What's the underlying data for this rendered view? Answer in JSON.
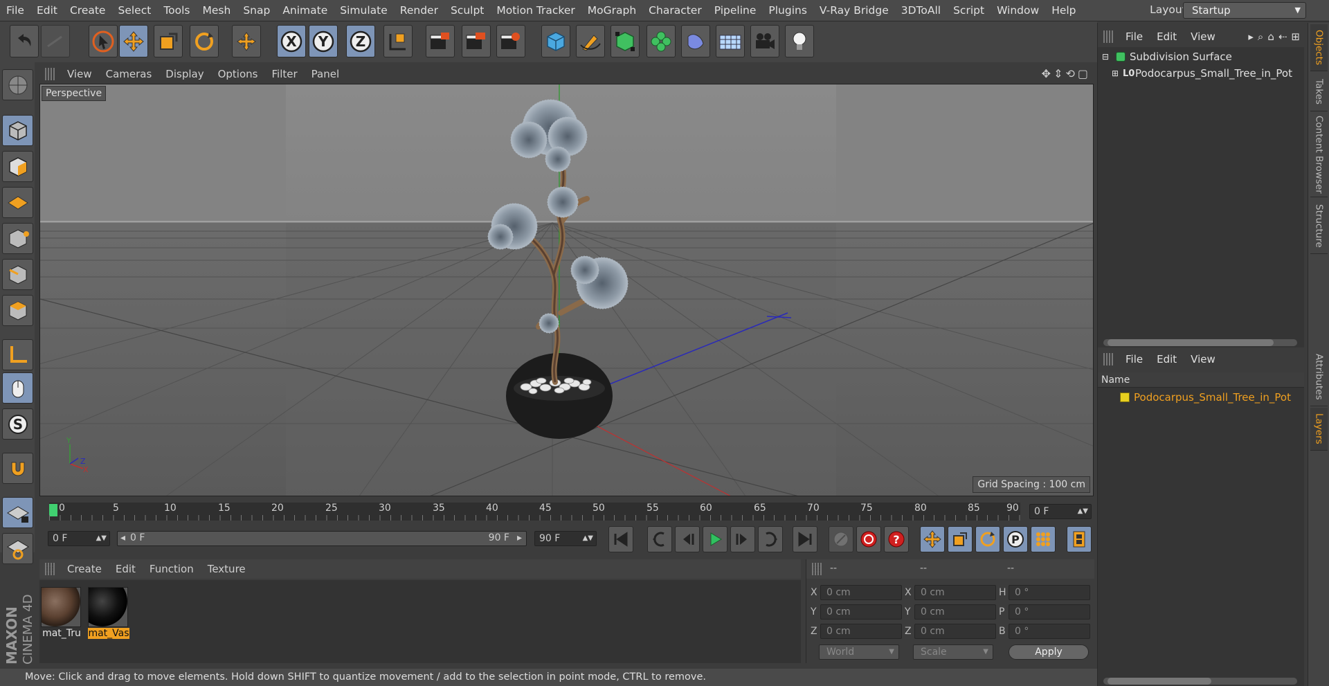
{
  "menubar": {
    "items": [
      "File",
      "Edit",
      "Create",
      "Select",
      "Tools",
      "Mesh",
      "Snap",
      "Animate",
      "Simulate",
      "Render",
      "Sculpt",
      "Motion Tracker",
      "MoGraph",
      "Character",
      "Pipeline",
      "Plugins",
      "V-Ray Bridge",
      "3DToAll",
      "Script",
      "Window",
      "Help"
    ],
    "layout_label": "Layout:",
    "layout_value": "Startup"
  },
  "toolbar": {
    "icons": [
      "undo-icon",
      "redo-icon",
      "select-arrow-icon",
      "move-icon",
      "scale-icon",
      "rotate-icon",
      "live-select-icon",
      "x-axis-icon",
      "y-axis-icon",
      "z-axis-icon",
      "coordinate-system-icon",
      "render-view-icon",
      "render-picture-viewer-icon",
      "render-settings-icon",
      "cube-icon",
      "pen-spline-icon",
      "subdivision-icon",
      "cloner-icon",
      "deformer-icon",
      "floor-icon",
      "camera-icon",
      "light-icon"
    ],
    "axis_labels": [
      "X",
      "Y",
      "Z"
    ]
  },
  "viewport": {
    "menu": [
      "View",
      "Cameras",
      "Display",
      "Options",
      "Filter",
      "Panel"
    ],
    "camera_label": "Perspective",
    "grid_spacing": "Grid Spacing : 100 cm",
    "axis_y": "Y",
    "axis_z": "Z",
    "axis_x": "X"
  },
  "timeline": {
    "ticks": [
      "0",
      "5",
      "10",
      "15",
      "20",
      "25",
      "30",
      "35",
      "40",
      "45",
      "50",
      "55",
      "60",
      "65",
      "70",
      "75",
      "80",
      "85",
      "90"
    ],
    "current_frame": "0 F",
    "start_field": "0 F",
    "range_start": "0 F",
    "range_end": "90 F",
    "end_field": "90 F"
  },
  "materials": {
    "menu": [
      "Create",
      "Edit",
      "Function",
      "Texture"
    ],
    "items": [
      {
        "name": "mat_Tru",
        "selected": false
      },
      {
        "name": "mat_Vas",
        "selected": true
      }
    ]
  },
  "coordinates": {
    "headers": [
      "--",
      "--",
      "--"
    ],
    "rows": [
      {
        "l1": "X",
        "v1": "0 cm",
        "l2": "X",
        "v2": "0 cm",
        "l3": "H",
        "v3": "0 °"
      },
      {
        "l1": "Y",
        "v1": "0 cm",
        "l2": "Y",
        "v2": "0 cm",
        "l3": "P",
        "v3": "0 °"
      },
      {
        "l1": "Z",
        "v1": "0 cm",
        "l2": "Z",
        "v2": "0 cm",
        "l3": "B",
        "v3": "0 °"
      }
    ],
    "mode1": "World",
    "mode2": "Scale",
    "apply": "Apply"
  },
  "objects_panel": {
    "menu": [
      "File",
      "Edit",
      "View"
    ],
    "tree": [
      {
        "name": "Subdivision Surface",
        "level": 0
      },
      {
        "name": "Podocarpus_Small_Tree_in_Pot",
        "level": 1
      }
    ]
  },
  "layers_panel": {
    "menu": [
      "File",
      "Edit",
      "View"
    ],
    "column": "Name",
    "items": [
      "Podocarpus_Small_Tree_in_Pot"
    ]
  },
  "side_tabs": [
    "Objects",
    "Takes",
    "Content Browser",
    "Structure",
    "Attributes",
    "Layers"
  ],
  "status": "Move: Click and drag to move elements. Hold down SHIFT to quantize movement / add to the selection in point mode, CTRL to remove.",
  "brand": {
    "line1": "MAXON",
    "line2": "CINEMA 4D"
  },
  "colors": {
    "accent": "#f0a020",
    "selected_tool": "#7e95b7",
    "viewport_bg": "#707070"
  }
}
